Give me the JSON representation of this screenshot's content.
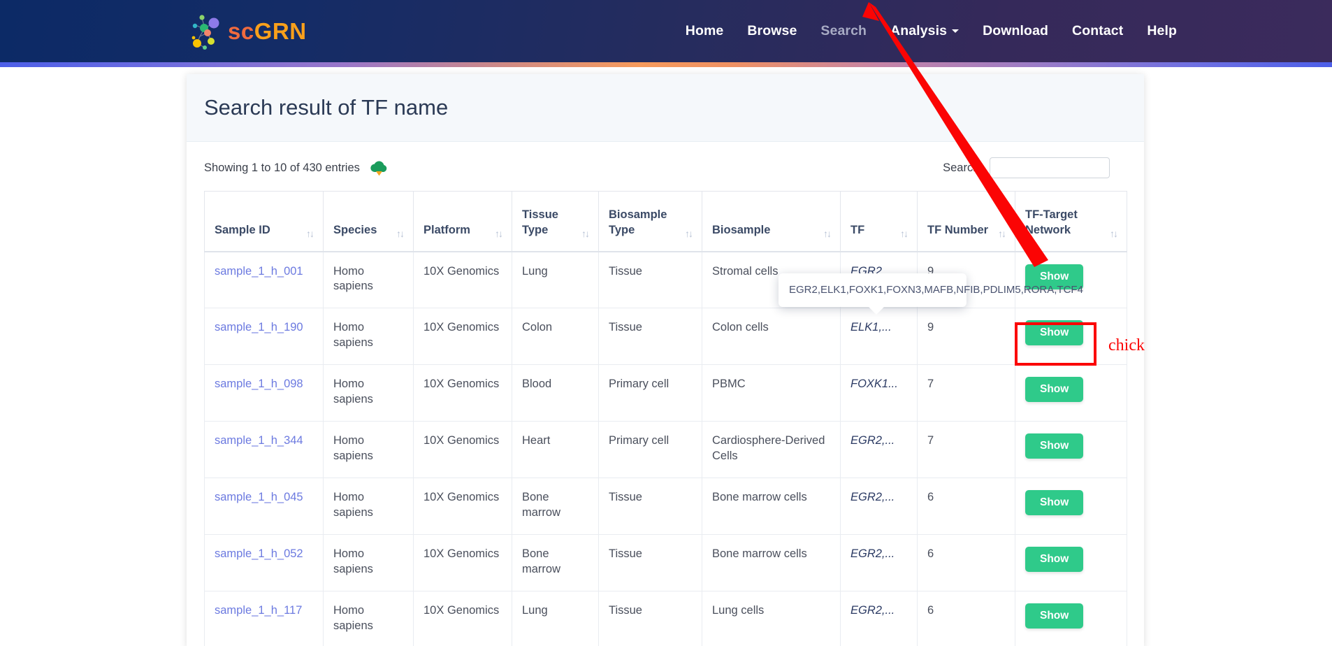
{
  "brand": {
    "prefix": "sc",
    "suffix": "GRN",
    "logo_icon": "network-nodes-logo"
  },
  "nav": {
    "items": [
      {
        "label": "Home",
        "state": "normal"
      },
      {
        "label": "Browse",
        "state": "normal"
      },
      {
        "label": "Search",
        "state": "muted"
      },
      {
        "label": "Analysis",
        "state": "dropdown"
      },
      {
        "label": "Download",
        "state": "normal"
      },
      {
        "label": "Contact",
        "state": "normal"
      },
      {
        "label": "Help",
        "state": "normal"
      }
    ]
  },
  "card": {
    "title": "Search result of TF name",
    "entries_info": "Showing 1 to 10 of 430 entries",
    "download_icon": "cloud-download-icon",
    "search_label": "Search:",
    "search_value": "",
    "search_placeholder": ""
  },
  "table": {
    "columns": [
      {
        "label": "Sample ID",
        "sort": "↑↓"
      },
      {
        "label": "Species",
        "sort": "↑↓"
      },
      {
        "label": "Platform",
        "sort": "↑↓"
      },
      {
        "label": "Tissue Type",
        "sort": "↑↓"
      },
      {
        "label": "Biosample Type",
        "sort": "↑↓"
      },
      {
        "label": "Biosample",
        "sort": "↑↓"
      },
      {
        "label": "TF",
        "sort": "↑↓"
      },
      {
        "label": "TF Number",
        "sort": "↑↓"
      },
      {
        "label": "TF-Target Network",
        "sort": "↑↓"
      }
    ],
    "rows": [
      {
        "sample_id": "sample_1_h_001",
        "species": "Homo sapiens",
        "platform": "10X Genomics",
        "tissue_type": "Lung",
        "biosample_type": "Tissue",
        "biosample": "Stromal cells",
        "tf": "EGR2,...",
        "tf_number": "9",
        "action": "Show"
      },
      {
        "sample_id": "sample_1_h_190",
        "species": "Homo sapiens",
        "platform": "10X Genomics",
        "tissue_type": "Colon",
        "biosample_type": "Tissue",
        "biosample": "Colon cells",
        "tf": "ELK1,...",
        "tf_number": "9",
        "action": "Show"
      },
      {
        "sample_id": "sample_1_h_098",
        "species": "Homo sapiens",
        "platform": "10X Genomics",
        "tissue_type": "Blood",
        "biosample_type": "Primary cell",
        "biosample": "PBMC",
        "tf": "FOXK1...",
        "tf_number": "7",
        "action": "Show"
      },
      {
        "sample_id": "sample_1_h_344",
        "species": "Homo sapiens",
        "platform": "10X Genomics",
        "tissue_type": "Heart",
        "biosample_type": "Primary cell",
        "biosample": "Cardiosphere-Derived Cells",
        "tf": "EGR2,...",
        "tf_number": "7",
        "action": "Show"
      },
      {
        "sample_id": "sample_1_h_045",
        "species": "Homo sapiens",
        "platform": "10X Genomics",
        "tissue_type": "Bone marrow",
        "biosample_type": "Tissue",
        "biosample": "Bone marrow cells",
        "tf": "EGR2,...",
        "tf_number": "6",
        "action": "Show"
      },
      {
        "sample_id": "sample_1_h_052",
        "species": "Homo sapiens",
        "platform": "10X Genomics",
        "tissue_type": "Bone marrow",
        "biosample_type": "Tissue",
        "biosample": "Bone marrow cells",
        "tf": "EGR2,...",
        "tf_number": "6",
        "action": "Show"
      },
      {
        "sample_id": "sample_1_h_117",
        "species": "Homo sapiens",
        "platform": "10X Genomics",
        "tissue_type": "Lung",
        "biosample_type": "Tissue",
        "biosample": "Lung cells",
        "tf": "EGR2,...",
        "tf_number": "6",
        "action": "Show"
      }
    ]
  },
  "tooltip": {
    "text": "EGR2,ELK1,FOXK1,FOXN3,MAFB,NFIB,PDLIM5,RORA,TCF4"
  },
  "annotation": {
    "label": "chick",
    "color": "#fb0404"
  },
  "colors": {
    "accent_green": "#2fca8a",
    "link_blue": "#6c7ae0",
    "brand_orange": "#f9a01b",
    "navbar_dark": "#12295f",
    "annotation_red": "#fb0404"
  }
}
